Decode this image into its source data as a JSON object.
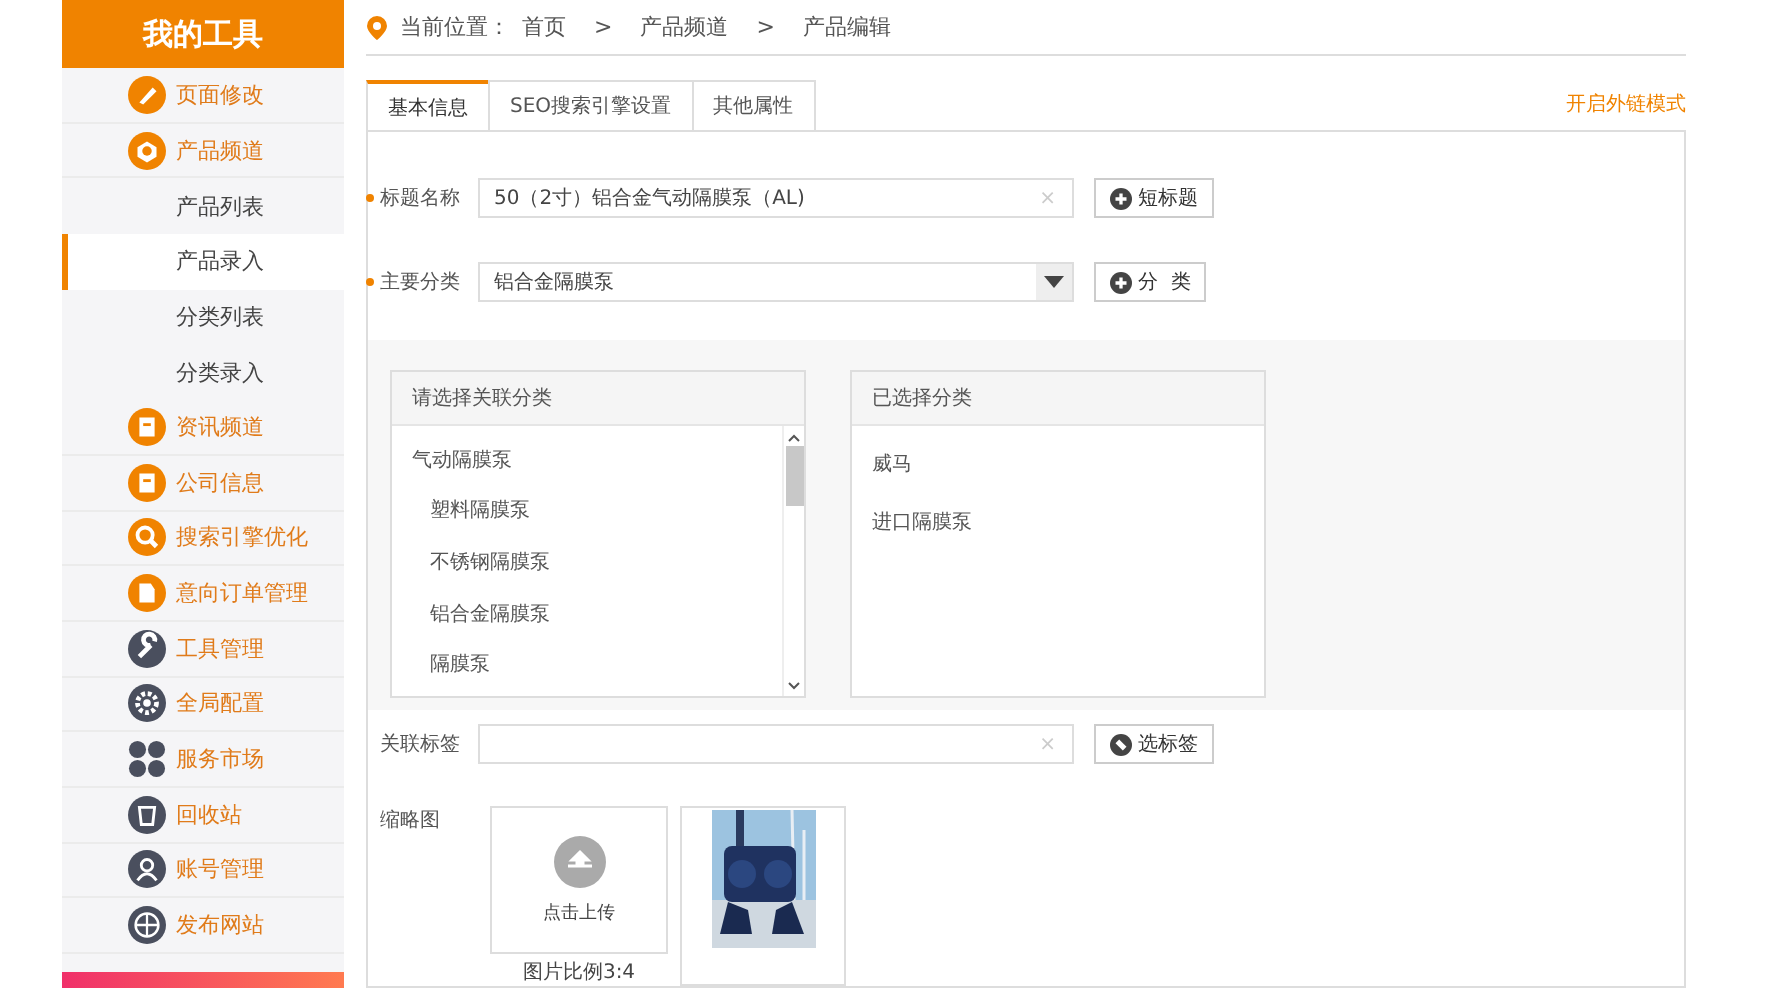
{
  "sidebar": {
    "title": "我的工具",
    "items": [
      {
        "kind": "menu",
        "label": "页面修改",
        "color": "#f08300",
        "selected": false
      },
      {
        "kind": "menu",
        "label": "产品频道",
        "color": "#f08300",
        "selected": false
      },
      {
        "kind": "submenu",
        "label": "产品列表",
        "selected": false
      },
      {
        "kind": "submenu",
        "label": "产品录入",
        "selected": true
      },
      {
        "kind": "submenu",
        "label": "分类列表",
        "selected": false
      },
      {
        "kind": "submenu",
        "label": "分类录入",
        "selected": false
      },
      {
        "kind": "menu",
        "label": "资讯频道",
        "color": "#f08300",
        "selected": false
      },
      {
        "kind": "menu",
        "label": "公司信息",
        "color": "#f08300",
        "selected": false
      },
      {
        "kind": "menu",
        "label": "搜索引擎优化",
        "color": "#f08300",
        "selected": false
      },
      {
        "kind": "menu",
        "label": "意向订单管理",
        "color": "#f08300",
        "selected": false
      },
      {
        "kind": "menu",
        "label": "工具管理",
        "color": "#4a4f5e",
        "selected": false
      },
      {
        "kind": "menu",
        "label": "全局配置",
        "color": "#4a4f5e",
        "selected": false
      },
      {
        "kind": "menu",
        "label": "服务市场",
        "color": "#4a4f5e",
        "selected": false
      },
      {
        "kind": "menu",
        "label": "回收站",
        "color": "#4a4f5e",
        "selected": false
      },
      {
        "kind": "menu",
        "label": "账号管理",
        "color": "#4a4f5e",
        "selected": false
      },
      {
        "kind": "menu",
        "label": "发布网站",
        "color": "#4a4f5e",
        "selected": false
      }
    ]
  },
  "breadcrumb": {
    "label": "当前位置：",
    "items": [
      "首页",
      "产品频道",
      "产品编辑"
    ],
    "separator": ">"
  },
  "tabs": [
    {
      "label": "基本信息",
      "selected": true
    },
    {
      "label": "SEO搜索引擎设置",
      "selected": false
    },
    {
      "label": "其他属性",
      "selected": false
    }
  ],
  "link_mode": "开启外链模式",
  "form": {
    "title": {
      "label": "标题名称",
      "required": true,
      "value": "50（2寸）铝合金气动隔膜泵（AL)",
      "clear": "×",
      "button": "短标题"
    },
    "category": {
      "label": "主要分类",
      "required": true,
      "value": "铝合金隔膜泵",
      "button": "分  类"
    },
    "available": {
      "heading": "请选择关联分类",
      "items": [
        {
          "label": "气动隔膜泵",
          "children": [
            {
              "label": "塑料隔膜泵"
            },
            {
              "label": "不锈钢隔膜泵"
            },
            {
              "label": "铝合金隔膜泵"
            },
            {
              "label": "隔膜泵"
            }
          ]
        }
      ]
    },
    "chosen": {
      "heading": "已选择分类",
      "items": [
        "威马",
        "进口隔膜泵"
      ]
    },
    "tags": {
      "label": "关联标签",
      "clear": "×",
      "button": "选标签"
    },
    "thumbnail": {
      "label": "缩略图",
      "upload": "点击上传",
      "hint": "图片比例3:4"
    }
  }
}
